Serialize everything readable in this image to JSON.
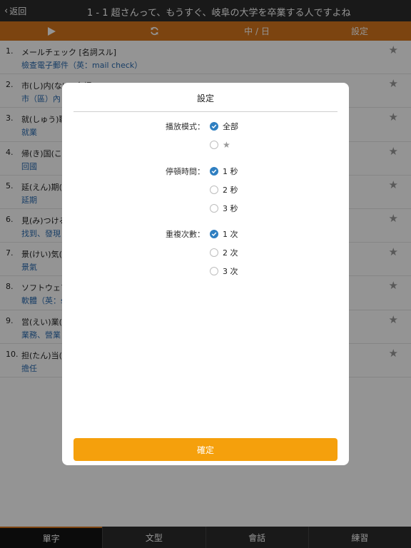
{
  "header": {
    "back_label": "返回",
    "title": "1 - 1 超さんって、もうすぐ、岐阜の大学を卒業する人ですよね"
  },
  "toolbar": {
    "play_icon": "play-icon",
    "refresh_icon": "refresh-icon",
    "lang_label": "中 / 日",
    "settings_label": "設定"
  },
  "words": [
    {
      "num": "1.",
      "word": "メールチェック  [名詞スル]",
      "meaning": "檢查電子郵件（英：mail check）"
    },
    {
      "num": "2.",
      "word": "市(し)内(ない)[名詞]",
      "meaning": "市（區）內"
    },
    {
      "num": "3.",
      "word": "就(しゅう)職",
      "meaning": "就業"
    },
    {
      "num": "4.",
      "word": "帰(き)国(こく",
      "meaning": "回國"
    },
    {
      "num": "5.",
      "word": "延(えん)期(き",
      "meaning": "延期"
    },
    {
      "num": "6.",
      "word": "見(み)つける",
      "meaning": "找到、發現"
    },
    {
      "num": "7.",
      "word": "景(けい)気(き",
      "meaning": "景氣"
    },
    {
      "num": "8.",
      "word": "ソフトウェア",
      "meaning": "軟體（英：s"
    },
    {
      "num": "9.",
      "word": "営(えい)業(ぎ",
      "meaning": "業務、營業"
    },
    {
      "num": "10.",
      "word": "担(たん)当(と",
      "meaning": "擔任"
    }
  ],
  "dialog": {
    "title": "設定",
    "play_mode": {
      "label": "播放模式：",
      "options": [
        "全部",
        "★"
      ],
      "selected": 0
    },
    "pause_time": {
      "label": "停頓時間：",
      "options": [
        "1 秒",
        "2 秒",
        "3 秒"
      ],
      "selected": 0
    },
    "repeat_count": {
      "label": "重複次數：",
      "options": [
        "1 次",
        "2 次",
        "3 次"
      ],
      "selected": 0
    },
    "confirm_label": "確定"
  },
  "tabs": [
    {
      "label": "單字",
      "active": true
    },
    {
      "label": "文型",
      "active": false
    },
    {
      "label": "會話",
      "active": false
    },
    {
      "label": "練習",
      "active": false
    }
  ],
  "colors": {
    "accent": "#d6761d",
    "confirm": "#f5a00c",
    "link": "#2b6cb0",
    "radio_on": "#2f7fc1"
  }
}
